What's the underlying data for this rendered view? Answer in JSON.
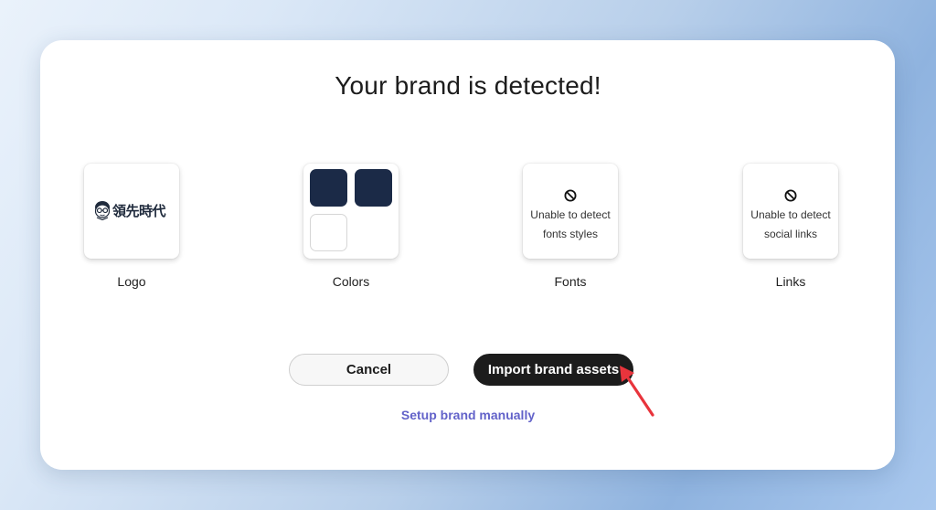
{
  "dialog": {
    "title": "Your brand is detected!"
  },
  "assets": {
    "logo": {
      "label": "Logo",
      "logo_text": "領先時代"
    },
    "colors": {
      "label": "Colors",
      "swatches": [
        "#1b2a47",
        "#1b2a47",
        "#ffffff"
      ]
    },
    "fonts": {
      "label": "Fonts",
      "line1": "Unable to detect",
      "line2": "fonts styles",
      "icon": "not-allowed-icon"
    },
    "links": {
      "label": "Links",
      "line1": "Unable to detect",
      "line2": "social links",
      "icon": "not-allowed-icon"
    }
  },
  "actions": {
    "cancel_label": "Cancel",
    "import_label": "Import brand assets",
    "manual_label": "Setup brand manually"
  },
  "colors": {
    "link": "#6262c9",
    "primary_button": "#1c1c1c",
    "annotation_arrow": "#e8343c"
  }
}
